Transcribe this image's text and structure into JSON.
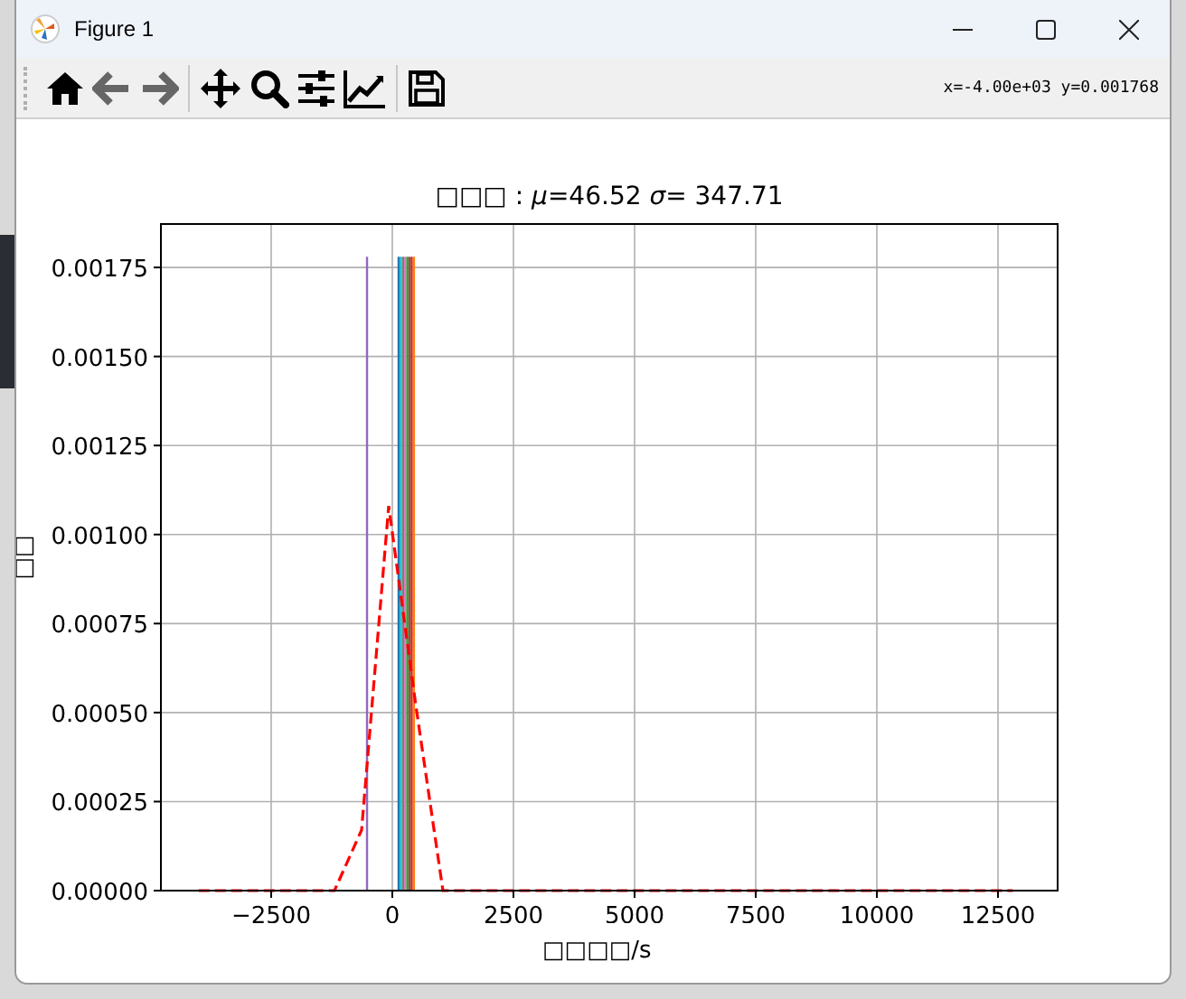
{
  "window": {
    "title": "Figure 1"
  },
  "toolbar": {
    "groups": [
      [
        {
          "kind": "home",
          "disabled": false
        },
        {
          "kind": "back",
          "disabled": true
        },
        {
          "kind": "forward",
          "disabled": true
        }
      ],
      [
        {
          "kind": "pan",
          "disabled": false
        },
        {
          "kind": "zoom",
          "disabled": false
        },
        {
          "kind": "configure",
          "disabled": false
        },
        {
          "kind": "edit",
          "disabled": false
        }
      ],
      [
        {
          "kind": "save",
          "disabled": false
        }
      ]
    ],
    "coordinates": "x=-4.00e+03 y=0.001768"
  },
  "figure": {
    "chart_data": {
      "type": "bar",
      "title": "□□□ : *μ*=46.52 *σ*= 347.71",
      "xlabel": "□□□□/s",
      "ylabel": "□□",
      "xlim": [
        -4776,
        13731
      ],
      "ylim": [
        0,
        0.001872
      ],
      "grid": true,
      "xticks": [
        {
          "value": -2500,
          "label": "−2500"
        },
        {
          "value": 0,
          "label": "0"
        },
        {
          "value": 2500,
          "label": "2500"
        },
        {
          "value": 5000,
          "label": "5000"
        },
        {
          "value": 7500,
          "label": "7500"
        },
        {
          "value": 10000,
          "label": "10000"
        },
        {
          "value": 12500,
          "label": "12500"
        }
      ],
      "yticks": [
        {
          "value": 0,
          "label": "0.00000"
        },
        {
          "value": 0.00025,
          "label": "0.00025"
        },
        {
          "value": 0.0005,
          "label": "0.00050"
        },
        {
          "value": 0.00075,
          "label": "0.00075"
        },
        {
          "value": 0.001,
          "label": "0.00100"
        },
        {
          "value": 0.00125,
          "label": "0.00125"
        },
        {
          "value": 0.0015,
          "label": "0.00150"
        },
        {
          "value": 0.00175,
          "label": "0.00175"
        }
      ],
      "series": [
        {
          "type": "bar",
          "color": "#9467bd",
          "x": [
            -522
          ],
          "values": [
            0.00178
          ]
        },
        {
          "type": "bar",
          "color": "#1f77b4",
          "x": [
            130
          ],
          "values": [
            0.00178
          ]
        },
        {
          "type": "bar",
          "color": "#17becf",
          "x": [
            175
          ],
          "values": [
            0.00178
          ]
        },
        {
          "type": "bar",
          "color": "#7f7f7f",
          "x": [
            220
          ],
          "values": [
            0.00178
          ]
        },
        {
          "type": "bar",
          "color": "#e377c2",
          "x": [
            265
          ],
          "values": [
            0.00178
          ]
        },
        {
          "type": "bar",
          "color": "#2ca02c",
          "x": [
            310
          ],
          "values": [
            0.00178
          ]
        },
        {
          "type": "bar",
          "color": "#8c564b",
          "x": [
            355
          ],
          "values": [
            0.00178
          ]
        },
        {
          "type": "bar",
          "color": "#d62728",
          "x": [
            400
          ],
          "values": [
            0.00178
          ]
        },
        {
          "type": "bar",
          "color": "#ff7f0e",
          "x": [
            445
          ],
          "values": [
            0.00178
          ]
        },
        {
          "type": "line",
          "color": "#ff0000",
          "line_style": "dashed",
          "x": [
            -3995,
            -3435,
            -2875,
            -2315,
            -1755,
            -1195,
            -635,
            -75,
            485,
            1045,
            1605,
            2165,
            2725,
            3285,
            3845,
            4405,
            4965,
            5525,
            6085,
            6645,
            7205,
            7765,
            8325,
            8885,
            9445,
            10005,
            10565,
            11125,
            11685,
            12245,
            12805
          ],
          "values": [
            0,
            0,
            0,
            0,
            0,
            0,
            0.00017,
            0.00108,
            0.00052,
            0,
            0,
            0,
            0,
            0,
            0,
            0,
            0,
            0,
            0,
            0,
            0,
            0,
            0,
            0,
            0,
            0,
            0,
            0,
            0,
            0,
            0
          ]
        }
      ]
    }
  }
}
